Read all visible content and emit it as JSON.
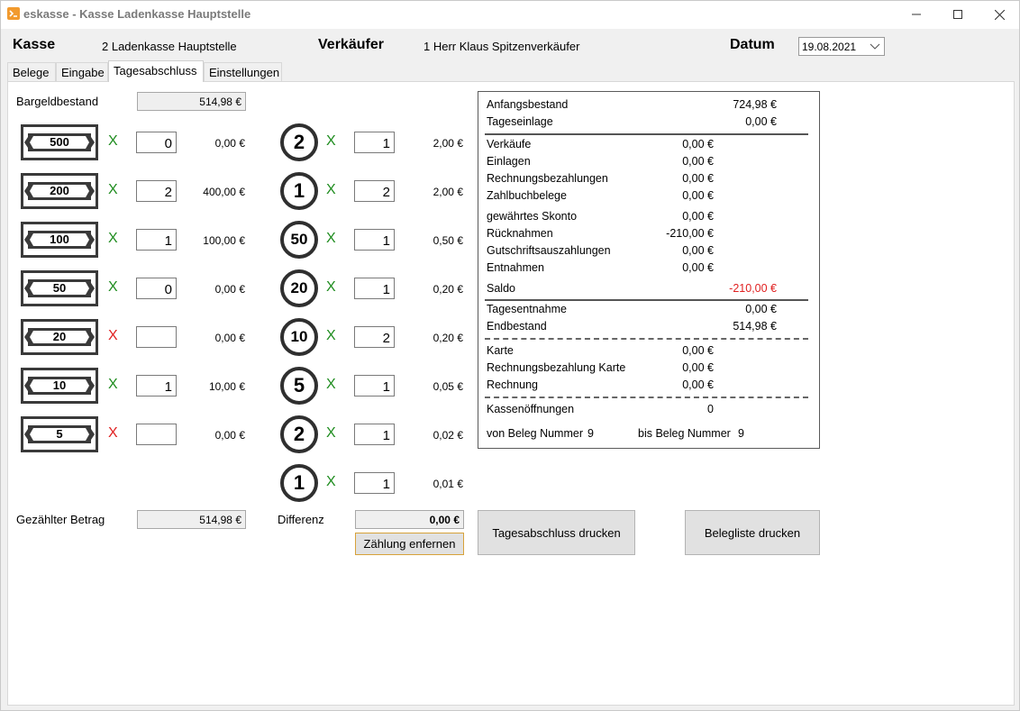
{
  "window": {
    "title": "eskasse - Kasse Ladenkasse Hauptstelle"
  },
  "header": {
    "kasse_label": "Kasse",
    "kasse_value": "2  Ladenkasse Hauptstelle",
    "verkaeufer_label": "Verkäufer",
    "verkaeufer_value": "1  Herr Klaus Spitzenverkäufer",
    "datum_label": "Datum",
    "datum_value": "19.08.2021"
  },
  "tabs": [
    "Belege",
    "Eingabe",
    "Tagesabschluss",
    "Einstellungen"
  ],
  "active_tab": "Tagesabschluss",
  "cash": {
    "bargeld_label": "Bargeldbestand",
    "bargeld_value": "514,98 €",
    "gezaehlt_label": "Gezählter Betrag",
    "gezaehlt_value": "514,98 €",
    "differenz_label": "Differenz",
    "differenz_value": "0,00 €",
    "remove_button": "Zählung enfernen"
  },
  "notes": [
    {
      "denom": "500",
      "count": "0",
      "sum": "0,00 €",
      "ok": true
    },
    {
      "denom": "200",
      "count": "2",
      "sum": "400,00 €",
      "ok": true
    },
    {
      "denom": "100",
      "count": "1",
      "sum": "100,00 €",
      "ok": true
    },
    {
      "denom": "50",
      "count": "0",
      "sum": "0,00 €",
      "ok": true
    },
    {
      "denom": "20",
      "count": "",
      "sum": "0,00 €",
      "ok": false
    },
    {
      "denom": "10",
      "count": "1",
      "sum": "10,00 €",
      "ok": true
    },
    {
      "denom": "5",
      "count": "",
      "sum": "0,00 €",
      "ok": false
    }
  ],
  "coins": [
    {
      "denom": "2",
      "count": "1",
      "sum": "2,00 €"
    },
    {
      "denom": "1",
      "count": "2",
      "sum": "2,00 €"
    },
    {
      "denom": "50",
      "count": "1",
      "sum": "0,50 €"
    },
    {
      "denom": "20",
      "count": "1",
      "sum": "0,20 €"
    },
    {
      "denom": "10",
      "count": "2",
      "sum": "0,20 €"
    },
    {
      "denom": "5",
      "count": "1",
      "sum": "0,05 €"
    },
    {
      "denom": "2",
      "count": "1",
      "sum": "0,02 €"
    },
    {
      "denom": "1",
      "count": "1",
      "sum": "0,01 €"
    }
  ],
  "multiply_symbol": "X",
  "summary": {
    "anfangsbestand": {
      "label": "Anfangsbestand",
      "value": "724,98 €"
    },
    "tageseinlage": {
      "label": "Tageseinlage",
      "value": "0,00 €"
    },
    "verkaeufe": {
      "label": "Verkäufe",
      "value": "0,00 €"
    },
    "einlagen": {
      "label": "Einlagen",
      "value": "0,00 €"
    },
    "rechnungsbezahlungen": {
      "label": "Rechnungsbezahlungen",
      "value": "0,00 €"
    },
    "zahlbuchbelege": {
      "label": "Zahlbuchbelege",
      "value": "0,00 €"
    },
    "skonto": {
      "label": "gewährtes Skonto",
      "value": "0,00 €"
    },
    "ruecknahmen": {
      "label": "Rücknahmen",
      "value": "-210,00 €"
    },
    "gutschriften": {
      "label": "Gutschriftsauszahlungen",
      "value": "0,00 €"
    },
    "entnahmen": {
      "label": "Entnahmen",
      "value": "0,00 €"
    },
    "saldo": {
      "label": "Saldo",
      "value": "-210,00 €"
    },
    "tagesentnahme": {
      "label": "Tagesentnahme",
      "value": "0,00 €"
    },
    "endbestand": {
      "label": "Endbestand",
      "value": "514,98 €"
    },
    "karte": {
      "label": "Karte",
      "value": "0,00 €"
    },
    "rechnungsbezahlung_karte": {
      "label": "Rechnungsbezahlung Karte",
      "value": "0,00 €"
    },
    "rechnung": {
      "label": "Rechnung",
      "value": "0,00 €"
    },
    "kassenoeffnungen": {
      "label": "Kassenöffnungen",
      "value": "0"
    },
    "von_beleg": {
      "label": "von Beleg Nummer",
      "value": "9"
    },
    "bis_beleg": {
      "label": "bis Beleg Nummer",
      "value": "9"
    }
  },
  "buttons": {
    "print_closing": "Tagesabschluss drucken",
    "print_receipts": "Belegliste drucken"
  },
  "colors": {
    "ok": "#1e8c1e",
    "bad": "#e02020",
    "negative": "#e02020",
    "app_icon": "#f29a2e"
  }
}
